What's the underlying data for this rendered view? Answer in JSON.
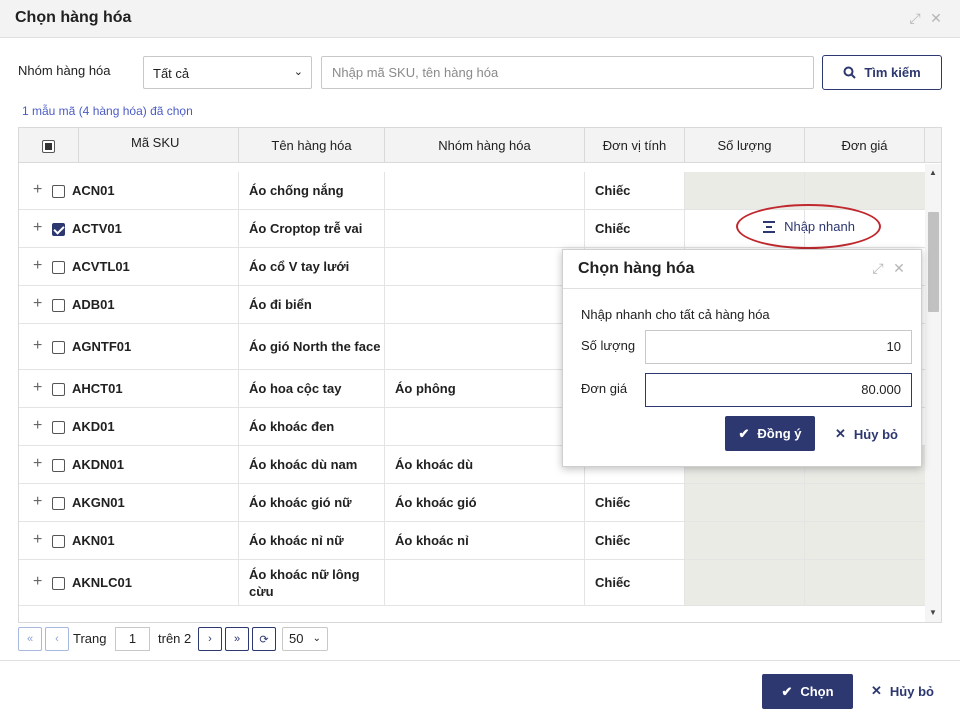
{
  "dialog": {
    "title": "Chọn hàng hóa"
  },
  "filter": {
    "group_label": "Nhóm hàng hóa",
    "group_value": "Tất cả",
    "search_placeholder": "Nhập mã SKU, tên hàng hóa",
    "search_button": "Tìm kiếm"
  },
  "selection_summary": "1 mẫu mã (4 hàng hóa) đã chọn",
  "table": {
    "columns": [
      "Mã SKU",
      "Tên hàng hóa",
      "Nhóm hàng hóa",
      "Đơn vị tính",
      "Số lượng",
      "Đơn giá"
    ],
    "rows": [
      {
        "sku": "ACN01",
        "name": "Áo chống nắng",
        "group": "",
        "unit": "Chiếc",
        "checked": false
      },
      {
        "sku": "ACTV01",
        "name": "Áo Croptop trễ vai",
        "group": "",
        "unit": "Chiếc",
        "checked": true
      },
      {
        "sku": "ACVTL01",
        "name": "Áo cổ V tay lưới",
        "group": "",
        "unit": "",
        "checked": false
      },
      {
        "sku": "ADB01",
        "name": "Áo đi biển",
        "group": "",
        "unit": "",
        "checked": false
      },
      {
        "sku": "AGNTF01",
        "name": "Áo gió North the face",
        "group": "",
        "unit": "",
        "checked": false
      },
      {
        "sku": "AHCT01",
        "name": "Áo hoa cộc tay",
        "group": "Áo phông",
        "unit": "",
        "checked": false
      },
      {
        "sku": "AKD01",
        "name": "Áo khoác đen",
        "group": "",
        "unit": "",
        "checked": false
      },
      {
        "sku": "AKDN01",
        "name": "Áo khoác dù nam",
        "group": "Áo khoác dù",
        "unit": "",
        "checked": false
      },
      {
        "sku": "AKGN01",
        "name": "Áo khoác gió nữ",
        "group": "Áo khoác gió",
        "unit": "Chiếc",
        "checked": false
      },
      {
        "sku": "AKN01",
        "name": "Áo khoác nỉ nữ",
        "group": "Áo khoác nỉ",
        "unit": "Chiếc",
        "checked": false
      },
      {
        "sku": "AKNLC01",
        "name": "Áo khoác nữ lông cừu",
        "group": "",
        "unit": "Chiếc",
        "checked": false
      }
    ],
    "quick_entry_label": "Nhập nhanh"
  },
  "pager": {
    "page_label": "Trang",
    "page": "1",
    "of_label": "trên 2",
    "page_size": "50"
  },
  "popup": {
    "title": "Chọn hàng hóa",
    "description": "Nhập nhanh cho tất cả hàng hóa",
    "qty_label": "Số lượng",
    "qty_value": "10",
    "price_label": "Đơn giá",
    "price_value": "80.000",
    "ok_label": "Đồng ý",
    "cancel_label": "Hủy bỏ"
  },
  "footer": {
    "choose_label": "Chọn",
    "cancel_label": "Hủy bỏ"
  },
  "colors": {
    "primary": "#2d3770",
    "highlight_circle": "#c0282d",
    "link": "#4a5cc4"
  }
}
